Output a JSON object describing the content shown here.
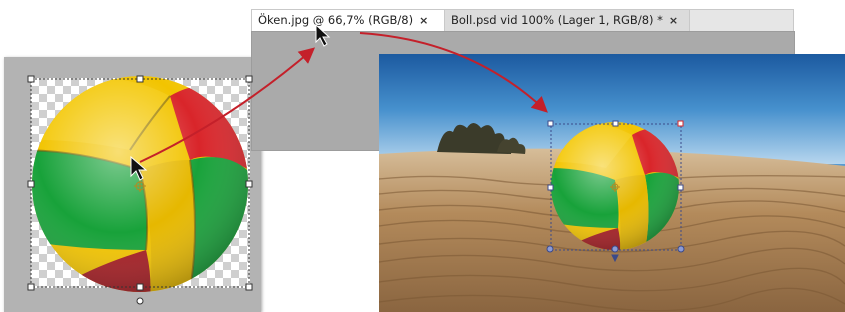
{
  "tabs": [
    {
      "label": "Öken.jpg @ 66,7% (RGB/8)",
      "close": "×",
      "active": true
    },
    {
      "label": "Boll.psd vid 100% (Lager 1, RGB/8) *",
      "close": "×",
      "active": false
    }
  ],
  "colors": {
    "ball_yellow": "#f2c400",
    "ball_red": "#d9252a",
    "ball_green": "#18a23a",
    "arrow": "#c4202a",
    "sky": "#2f77bd",
    "sand": "#b98f60"
  },
  "icons": [
    "mouse-pointer-icon",
    "mouse-pointer-icon",
    "transform-center-icon"
  ]
}
